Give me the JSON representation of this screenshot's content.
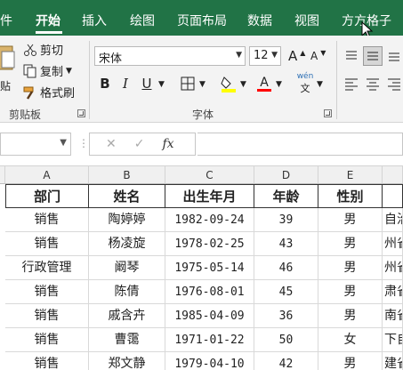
{
  "ribbon_tabs": [
    "件",
    "开始",
    "插入",
    "绘图",
    "页面布局",
    "数据",
    "视图",
    "方方格子"
  ],
  "clipboard": {
    "cut": "剪切",
    "copy": "复制",
    "format_painter": "格式刷",
    "paste_partial": "贴",
    "group": "剪贴板"
  },
  "font": {
    "name": "宋体",
    "size": "12",
    "grow": "A",
    "shrink": "A",
    "bold": "B",
    "italic": "I",
    "underline": "U",
    "phonetic": "wén",
    "group": "字体"
  },
  "colors": {
    "ribbon_green": "#217346",
    "highlight": "#ffff00",
    "font_color": "#ff0000"
  },
  "formula_bar": {
    "name_box": "",
    "cancel": "✕",
    "enter": "✓",
    "fx": "fx",
    "content": ""
  },
  "columns": [
    "A",
    "B",
    "C",
    "D",
    "E"
  ],
  "table": {
    "headers": [
      "部门",
      "姓名",
      "出生年月",
      "年龄",
      "性别",
      ""
    ],
    "rows": [
      [
        "销售",
        "陶婷婷",
        "1982-09-24",
        "39",
        "男",
        "自治"
      ],
      [
        "销售",
        "杨凌旋",
        "1978-02-25",
        "43",
        "男",
        "州省"
      ],
      [
        "行政管理",
        "阚琴",
        "1975-05-14",
        "46",
        "男",
        "州省"
      ],
      [
        "销售",
        "陈倩",
        "1976-08-01",
        "45",
        "男",
        "肃省"
      ],
      [
        "销售",
        "戚含卉",
        "1985-04-09",
        "36",
        "男",
        "南省"
      ],
      [
        "销售",
        "曹霭",
        "1971-01-22",
        "50",
        "女",
        "下自"
      ],
      [
        "销售",
        "郑文静",
        "1979-04-10",
        "42",
        "男",
        "建省"
      ]
    ]
  }
}
